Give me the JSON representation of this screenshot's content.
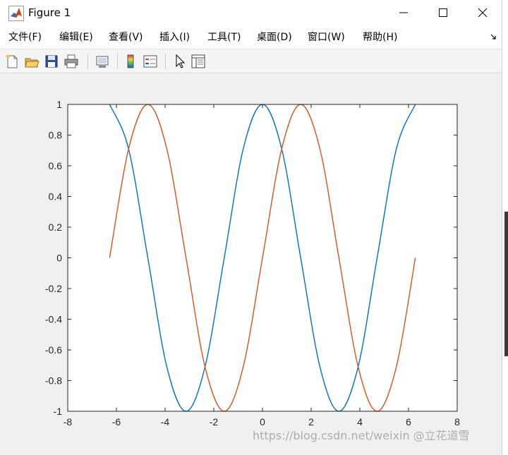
{
  "window": {
    "title": "Figure 1"
  },
  "menu": {
    "items": [
      {
        "label": "文件(F)"
      },
      {
        "label": "编辑(E)"
      },
      {
        "label": "查看(V)"
      },
      {
        "label": "插入(I)"
      },
      {
        "label": "工具(T)"
      },
      {
        "label": "桌面(D)"
      },
      {
        "label": "窗口(W)"
      },
      {
        "label": "帮助(H)"
      }
    ]
  },
  "toolbar": {
    "icons": [
      "new-figure-icon",
      "open-file-icon",
      "save-icon",
      "print-icon",
      "link-plot-icon",
      "colorbar-icon",
      "legend-icon",
      "edit-plot-arrow-icon",
      "property-inspector-icon"
    ]
  },
  "watermark": {
    "text": "https://blog.csdn.net/weixin @立花道雪"
  },
  "colors": {
    "series1": "#0072BD",
    "series2": "#D95319",
    "axes": "#262626",
    "plot_bg": "#ffffff",
    "figure_bg": "#f0f0f0"
  },
  "chart_data": {
    "type": "line",
    "title": "",
    "xlabel": "",
    "ylabel": "",
    "xlim": [
      -8,
      8
    ],
    "ylim": [
      -1,
      1
    ],
    "xticks": [
      -8,
      -6,
      -4,
      -2,
      0,
      2,
      4,
      6,
      8
    ],
    "yticks": [
      -1,
      -0.8,
      -0.6,
      -0.4,
      -0.2,
      0,
      0.2,
      0.4,
      0.6,
      0.8,
      1
    ],
    "xtick_labels": [
      "-8",
      "-6",
      "-4",
      "-2",
      "0",
      "2",
      "4",
      "6",
      "8"
    ],
    "ytick_labels": [
      "-1",
      "-0.8",
      "-0.6",
      "-0.4",
      "-0.2",
      "0",
      "0.2",
      "0.4",
      "0.6",
      "0.8",
      "1"
    ],
    "grid": false,
    "series": [
      {
        "color": "#0072BD",
        "x": [
          -6.28,
          -5.5,
          -4.71,
          -3.93,
          -3.14,
          -2.36,
          -1.57,
          -0.79,
          0,
          0.79,
          1.57,
          2.36,
          3.14,
          3.93,
          4.71,
          5.5,
          6.28
        ],
        "y": [
          1,
          0.71,
          0,
          -0.71,
          -1,
          -0.71,
          0,
          0.71,
          1,
          0.71,
          0,
          -0.71,
          -1,
          -0.71,
          0,
          0.71,
          1
        ]
      },
      {
        "color": "#D95319",
        "x": [
          -6.28,
          -5.5,
          -4.71,
          -3.93,
          -3.14,
          -2.36,
          -1.57,
          -0.79,
          0,
          0.79,
          1.57,
          2.36,
          3.14,
          3.93,
          4.71,
          5.5,
          6.28
        ],
        "y": [
          0,
          0.71,
          1,
          0.71,
          0,
          -0.71,
          -1,
          -0.71,
          0,
          0.71,
          1,
          0.71,
          0,
          -0.71,
          -1,
          -0.71,
          0
        ]
      }
    ]
  }
}
